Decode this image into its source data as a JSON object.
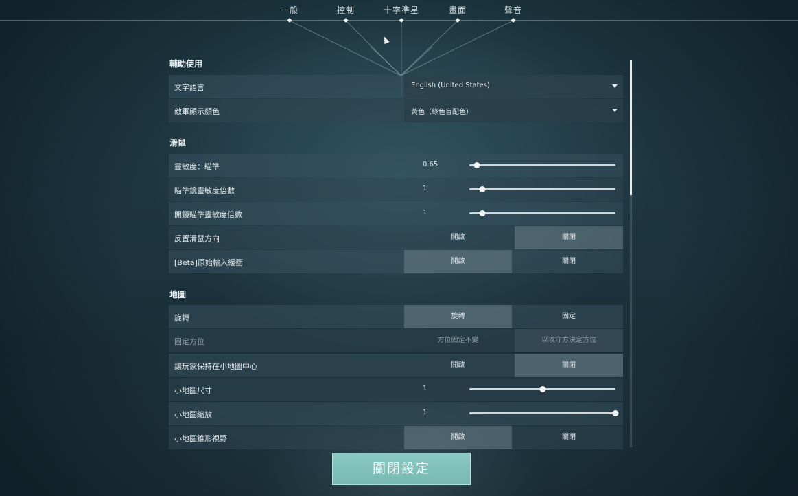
{
  "tabs": [
    {
      "label": "一般"
    },
    {
      "label": "控制"
    },
    {
      "label": "十字準星"
    },
    {
      "label": "畫面"
    },
    {
      "label": "聲音"
    }
  ],
  "sections": {
    "accessibility": "輔助使用",
    "mouse": "滑鼠",
    "map": "地圖"
  },
  "accessibility": {
    "language": {
      "label": "文字語言",
      "value": "English (United States)"
    },
    "enemy_color": {
      "label": "敵軍顯示顏色",
      "value": "黃色（綠色盲配色）"
    }
  },
  "mouse": {
    "sensitivity": {
      "label": "靈敏度：瞄準",
      "value": "0.65",
      "level": 0.05
    },
    "scope_sens": {
      "label": "瞄準鏡靈敏度倍數",
      "value": "1",
      "level": 0.09
    },
    "ads_sens": {
      "label": "開鏡瞄準靈敏度倍數",
      "value": "1",
      "level": 0.09
    },
    "invert": {
      "label": "反置滑鼠方向",
      "on": "開啟",
      "off": "關閉",
      "selected": "off"
    },
    "raw_input": {
      "label": "[Beta]原始輸入緩衝",
      "on": "開啟",
      "off": "關閉",
      "selected": "on"
    }
  },
  "map": {
    "rotate": {
      "label": "旋轉",
      "opt_a": "旋轉",
      "opt_b": "固定",
      "selected": "a"
    },
    "fixed_orientation": {
      "label": "固定方位",
      "opt_a": "方位固定不變",
      "opt_b": "以攻守方決定方位",
      "selected": "b"
    },
    "keep_center": {
      "label": "讓玩家保持在小地圖中心",
      "on": "開啟",
      "off": "關閉",
      "selected": "off"
    },
    "minimap_size": {
      "label": "小地圖尺寸",
      "value": "1",
      "level": 0.5
    },
    "minimap_zoom": {
      "label": "小地圖縮放",
      "value": "1",
      "level": 1.0
    },
    "minimap_cone": {
      "label": "小地圖錐形視野",
      "on": "開啟",
      "off": "關閉",
      "selected": "on"
    }
  },
  "close_button": "關閉設定",
  "colors": {
    "accent": "#7fc0b9",
    "panel": "#37505c"
  }
}
